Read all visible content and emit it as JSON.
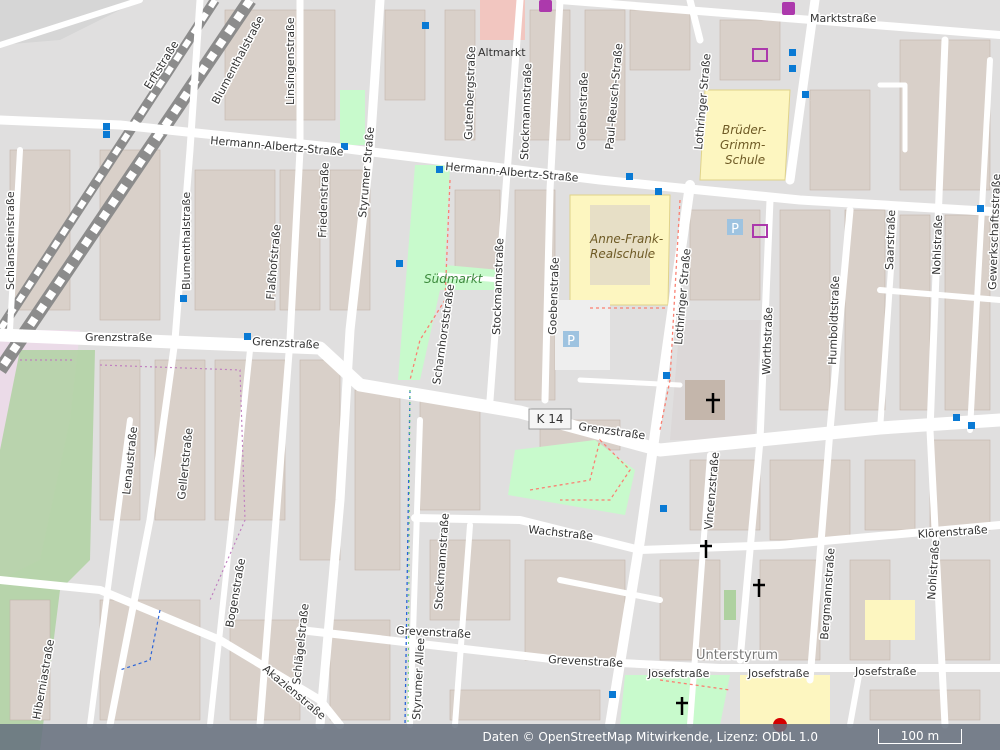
{
  "streets": {
    "marktstrasse": "Marktstraße",
    "erftstrasse": "Erftstraße",
    "blumenthalstrasse_top": "Blumenthalstraße",
    "linsingenstrasse": "Linsingenstraße",
    "gutenbergstrasse": "Gutenbergstraße",
    "stockmannstrasse_top": "Stockmannstraße",
    "goebenstrasse_top": "Goebenstraße",
    "paul_reusch_strasse": "Paul-Reusch-Straße",
    "lothringer_strasse_top": "Lothringer Straße",
    "hermann_albertz_left": "Hermann-Albertz-Straße",
    "hermann_albertz_right": "Hermann-Albertz-Straße",
    "schlanstein": "Schlansteinstraße",
    "blumenthalstrasse_mid": "Blumenthalstraße",
    "flassbofstrasse": "Flaßhofstraße",
    "friedenstrasse": "Friedenstraße",
    "styrumer_strasse": "Styrumer Straße",
    "stockmannstrasse_mid": "Stockmannstraße",
    "goebenstrasse_mid": "Goebenstraße",
    "lothringer_strasse_mid": "Lothringer Straße",
    "woerthstrasse": "Wörthstraße",
    "humboldtstrasse": "Humboldtstraße",
    "saarstrasse": "Saarstraße",
    "nohlstrasse": "Nohlstraße",
    "gewerkschaftsstrasse": "Gewerkschaftsstraße",
    "grenzstrasse_1": "Grenzstraße",
    "grenzstrasse_2": "Grenzstraße",
    "grenzstrasse_3": "Grenzstraße",
    "scharnhorststrasse": "Scharnhorststraße",
    "lenaustrasse": "Lenaustraße",
    "gellertstrasse": "Gellertstraße",
    "schlaegelstrasse": "Schlägelstraße",
    "wachstrasse": "Wachstraße",
    "vincenzstrasse": "Vincenzstraße",
    "kloerenstrasse": "Klörenstraße",
    "nohlstrasse_low": "Nohlstraße",
    "bogenstrasse": "Bogenstraße",
    "stockmannstrasse_low": "Stockmannstraße",
    "bergmannstrasse": "Bergmannstraße",
    "grevenstrasse_1": "Grevenstraße",
    "grevenstrasse_2": "Grevenstraße",
    "josefstrasse_1": "Josefstraße",
    "josefstrasse_2": "Josefstraße",
    "josefstrasse_3": "Josefstraße",
    "hibernia": "Hiberniastraße",
    "akazien": "Akazienstraße",
    "styrumer_allee": "Styrumer Allee"
  },
  "pois": {
    "altmarkt": "Altmarkt",
    "sudmarkt": "Südmarkt",
    "anne_frank_1": "Anne-Frank-",
    "anne_frank_2": "Realschule",
    "brueder_1": "Brüder-",
    "brueder_2": "Grimm-",
    "brueder_3": "Schule",
    "district": "Unterstyrum",
    "road_ref": "K 14",
    "parking": "P"
  },
  "footer": {
    "attribution": "Daten © OpenStreetMap Mitwirkende, Lizenz: ODbL 1.0",
    "scale": "100 m"
  },
  "colors": {
    "background": "#e0dfdf",
    "road": "#ffffff",
    "building": "#d9d0c9",
    "park": "#c8facc",
    "school": "#fdf6c0",
    "bus_stop": "#0a7ad4",
    "railway": "#8c8c8c"
  }
}
